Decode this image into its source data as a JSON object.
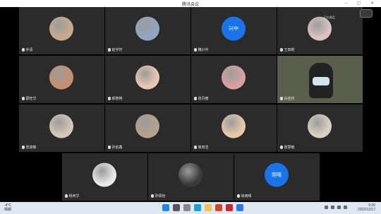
{
  "window": {
    "title": "腾讯会议"
  },
  "participants": [
    {
      "name": "乔清",
      "avatar": "photo-avatar",
      "color": "#c9a98a"
    },
    {
      "name": "赵宇轩",
      "avatar": "photo-avatar",
      "color": "#8fa7c2"
    },
    {
      "name": "魏兴中",
      "avatar": "text-avatar",
      "avatar_text": "兴中",
      "color": "#1a73e8"
    },
    {
      "name": "王田莉",
      "avatar": "photo-avatar",
      "color": "#d9c3c3",
      "badge": "正在说话"
    },
    {
      "name": "邵旺华",
      "avatar": "photo-avatar",
      "color": "#c78f6b"
    },
    {
      "name": "郝春艳",
      "avatar": "photo-avatar",
      "color": "#e8c7b2"
    },
    {
      "name": "张丹丽",
      "avatar": "photo-avatar",
      "color": "#d8a0a0"
    },
    {
      "name": "白佳庆",
      "avatar": "video",
      "color": "#5a5f4c"
    },
    {
      "name": "张淑敏",
      "avatar": "photo-avatar",
      "color": "#d4c7b5"
    },
    {
      "name": "孙伯鑫",
      "avatar": "photo-avatar",
      "color": "#b7a08a"
    },
    {
      "name": "南田洁",
      "avatar": "photo-avatar",
      "color": "#e6c9a8"
    },
    {
      "name": "张慧敏",
      "avatar": "photo-avatar",
      "color": "#d9d0c2"
    },
    {
      "name": "杨丙华",
      "avatar": "photo-avatar",
      "color": "#e8e8e8"
    },
    {
      "name": "孙倩怡",
      "avatar": "photo-avatar",
      "color": "#3b3b3b"
    },
    {
      "name": "徐雨晴",
      "avatar": "text-avatar",
      "avatar_text": "雨晴",
      "color": "#1a73e8"
    }
  ],
  "taskbar": {
    "weather_temp": "-4°C",
    "weather_desc": "晴朗",
    "time": "9:30",
    "date": "2022/12/17"
  }
}
